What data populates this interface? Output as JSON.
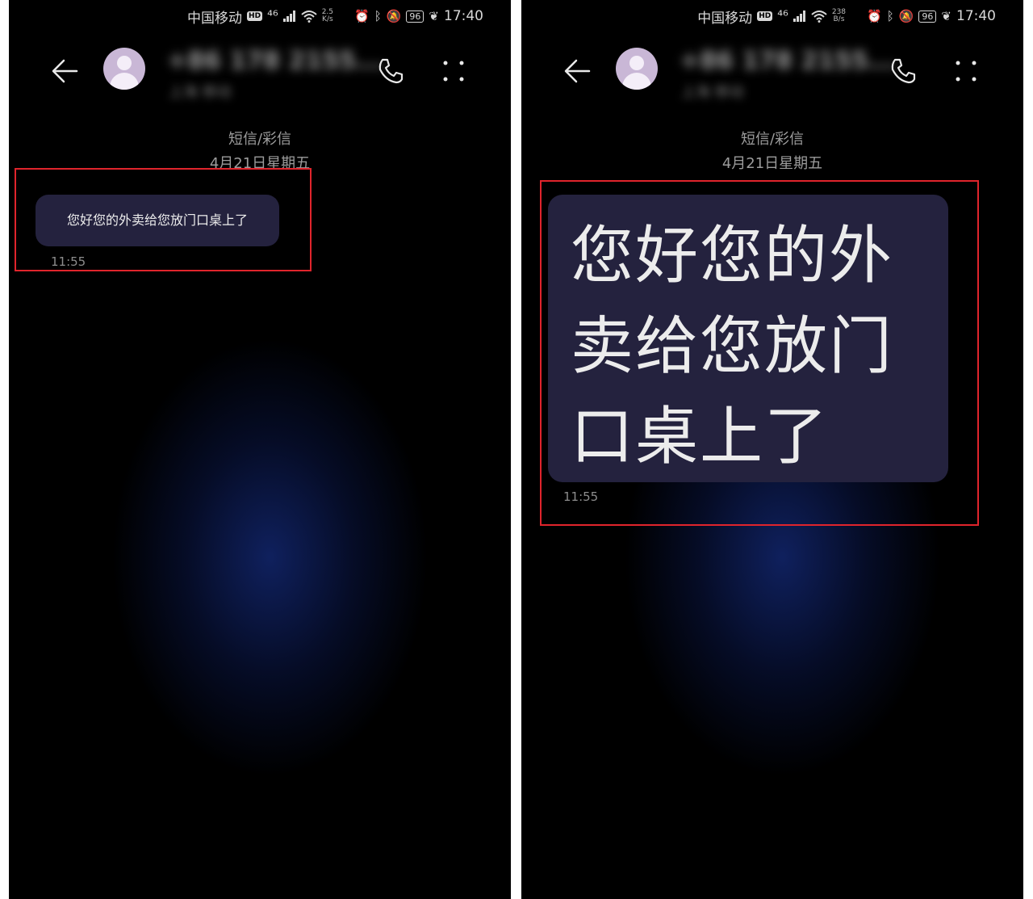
{
  "screens": [
    {
      "status": {
        "carrier": "中国移动",
        "hd": "HD",
        "net": "⁴⁶",
        "speed_value": "2.5",
        "speed_unit": "K/s",
        "battery": "96",
        "time": "17:40"
      },
      "header": {
        "contact_name": "+86 178 2155...",
        "contact_sub": "上海 移动"
      },
      "message_type": "短信/彩信",
      "date": "4月21日星期五",
      "message": {
        "text": "您好您的外卖给您放门口桌上了",
        "time": "11:55"
      }
    },
    {
      "status": {
        "carrier": "中国移动",
        "hd": "HD",
        "net": "⁴⁶",
        "speed_value": "238",
        "speed_unit": "B/s",
        "battery": "96",
        "time": "17:40"
      },
      "header": {
        "contact_name": "+86 178 2155...",
        "contact_sub": "上海 移动"
      },
      "message_type": "短信/彩信",
      "date": "4月21日星期五",
      "message": {
        "text": "您好您的外卖给您放门口桌上了",
        "time": "11:55"
      }
    }
  ],
  "colors": {
    "highlight": "#e0242c",
    "bubble": "#24223e",
    "avatar": "#c9b7d6"
  }
}
